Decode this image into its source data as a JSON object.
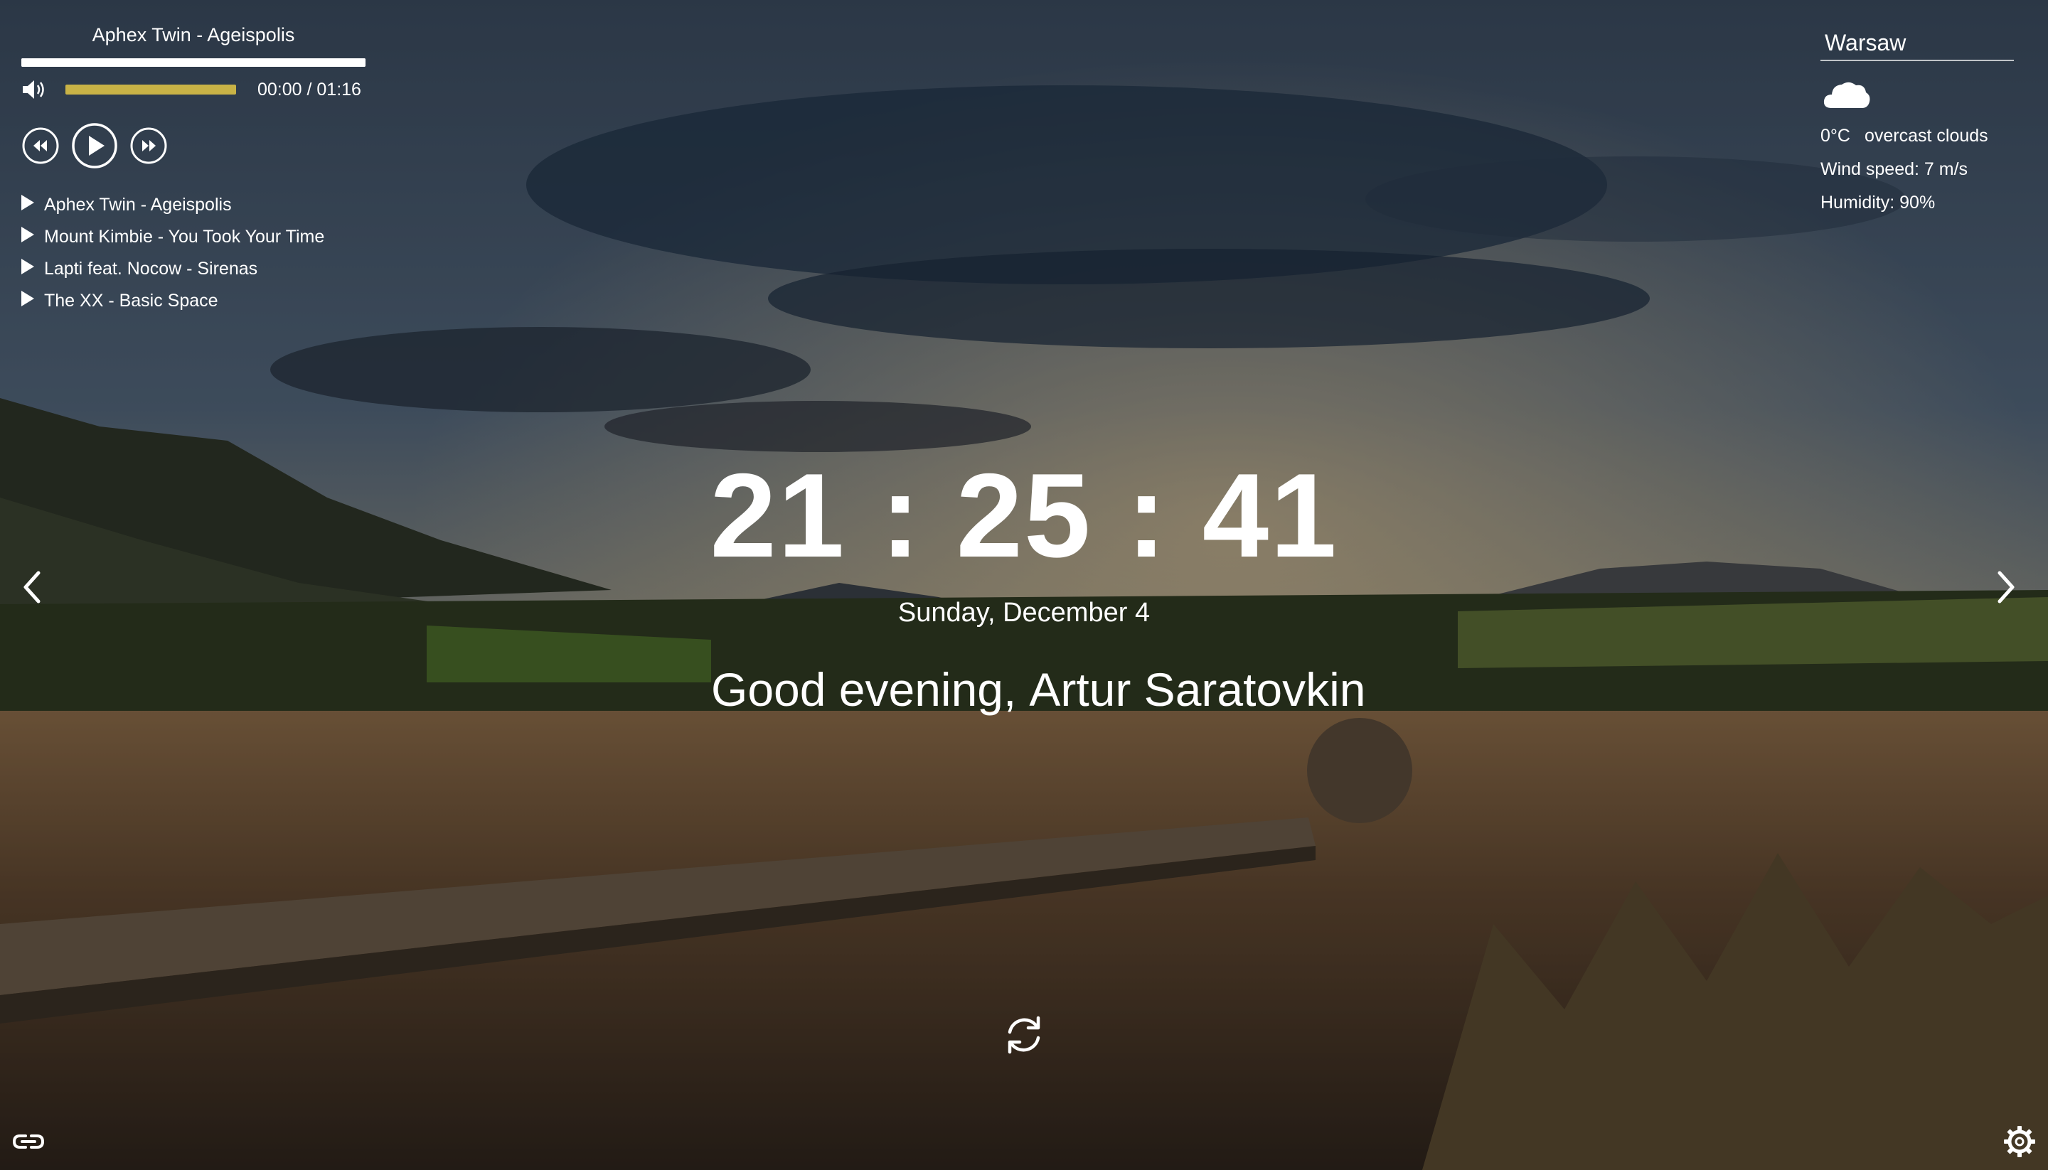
{
  "player": {
    "now_playing": "Aphex Twin - Ageispolis",
    "progress_fraction": 1.0,
    "volume_fraction": 1.0,
    "time_display": "00:00 / 01:16",
    "playlist": [
      "Aphex Twin - Ageispolis",
      "Mount Kimbie - You Took Your Time",
      "Lapti feat. Nocow - Sirenas",
      "The XX - Basic Space"
    ]
  },
  "weather": {
    "city": "Warsaw",
    "icon": "overcast-clouds-icon",
    "temperature": "0°C",
    "description": "overcast clouds",
    "wind": "Wind speed: 7 m/s",
    "humidity": "Humidity: 90%"
  },
  "clock": {
    "time": "21 : 25 : 41"
  },
  "date": "Sunday, December 4",
  "greeting": {
    "salutation": "Good evening,",
    "name": "Artur Saratovkin"
  },
  "colors": {
    "progress_fill": "#c9b36a",
    "volume_fill": "#c9b346",
    "text": "#ffffff"
  },
  "icons": {
    "volume": "speaker-icon",
    "prev": "rewind-icon",
    "play": "play-icon",
    "next": "fast-forward-icon",
    "slide_prev": "chevron-left-icon",
    "slide_next": "chevron-right-icon",
    "refresh": "refresh-icon",
    "link": "link-icon",
    "settings": "gear-icon"
  }
}
